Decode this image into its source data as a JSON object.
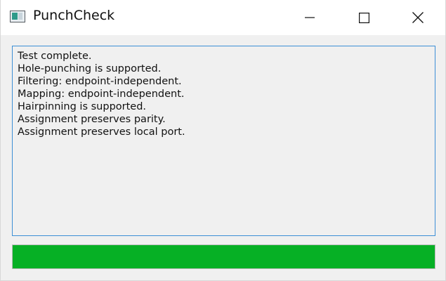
{
  "window": {
    "title": "PunchCheck",
    "icon": "app-window-icon",
    "controls": {
      "minimize_icon": "minimize-icon",
      "maximize_icon": "maximize-icon",
      "close_icon": "close-icon"
    }
  },
  "log": {
    "lines": [
      "Test complete.",
      "Hole-punching is supported.",
      "Filtering: endpoint-independent.",
      "Mapping: endpoint-independent.",
      "Hairpinning is supported.",
      "Assignment preserves parity.",
      "Assignment preserves local port."
    ]
  },
  "progress": {
    "value": 1.0,
    "color": "#06b025"
  },
  "colors": {
    "accent_border": "#3c8fd6",
    "window_bg": "#f0f0f0",
    "titlebar_bg": "#ffffff"
  }
}
